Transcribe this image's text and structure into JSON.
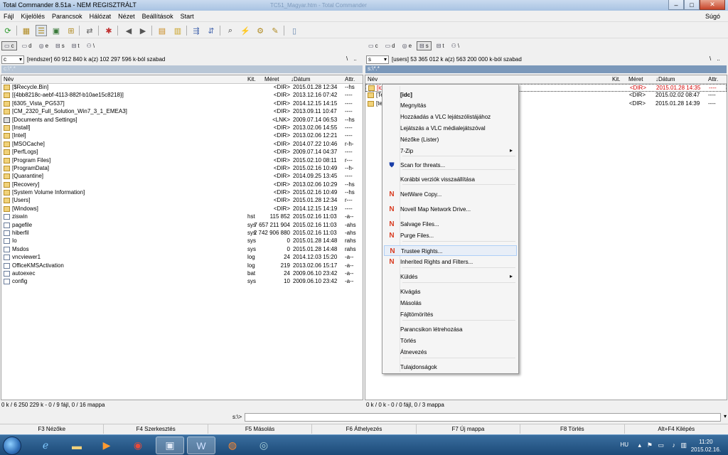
{
  "window": {
    "title": "Total Commander 8.51a - NEM REGISZTRÁLT",
    "blur_text": "TC51_Magyar.htm - Total Commander",
    "min_icon": "minimize-icon",
    "max_icon": "maximize-icon",
    "close_icon": "close-icon"
  },
  "menu": {
    "items": [
      "Fájl",
      "Kijelölés",
      "Parancsok",
      "Hálózat",
      "Nézet",
      "Beállítások",
      "Start"
    ],
    "help": "Súgó"
  },
  "left": {
    "drives": [
      "c",
      "d",
      "e",
      "s",
      "t",
      "\\"
    ],
    "drive_combo": "c",
    "free_space": "[rendszer]  60 912 840 k a(z) 102 297 596 k-ból szabad",
    "nav": [
      "\\",
      ".."
    ],
    "path": "c:\\*.*",
    "columns": {
      "name": "Név",
      "ext": "Kit.",
      "size": "Méret",
      "date": "↓Dátum",
      "attr": "Attr."
    },
    "rows": [
      {
        "type": "folder",
        "name": "[$Recycle.Bin]",
        "ext": "",
        "size": "<DIR>",
        "date": "2015.01.28 12:34",
        "attr": "--hs"
      },
      {
        "type": "folder",
        "name": "[{4bb8218c-aebf-4113-882f-b10ae15c8218}]",
        "ext": "",
        "size": "<DIR>",
        "date": "2013.12.16 07:42",
        "attr": "----"
      },
      {
        "type": "folder",
        "name": "[6305_Vista_PG537]",
        "ext": "",
        "size": "<DIR>",
        "date": "2014.12.15 14:15",
        "attr": "----"
      },
      {
        "type": "folder",
        "name": "[CM_2320_Full_Solution_Win7_3_1_EMEA3]",
        "ext": "",
        "size": "<DIR>",
        "date": "2013.09.11 10:47",
        "attr": "----"
      },
      {
        "type": "lnk",
        "name": "[Documents and Settings]",
        "ext": "",
        "size": "<LNK>",
        "date": "2009.07.14 06:53",
        "attr": "--hs"
      },
      {
        "type": "folder",
        "name": "[Install]",
        "ext": "",
        "size": "<DIR>",
        "date": "2013.02.06 14:55",
        "attr": "----"
      },
      {
        "type": "folder",
        "name": "[Intel]",
        "ext": "",
        "size": "<DIR>",
        "date": "2013.02.06 12:21",
        "attr": "----"
      },
      {
        "type": "folder",
        "name": "[MSOCache]",
        "ext": "",
        "size": "<DIR>",
        "date": "2014.07.22 10:46",
        "attr": "r-h-"
      },
      {
        "type": "folder",
        "name": "[PerfLogs]",
        "ext": "",
        "size": "<DIR>",
        "date": "2009.07.14 04:37",
        "attr": "----"
      },
      {
        "type": "folder",
        "name": "[Program Files]",
        "ext": "",
        "size": "<DIR>",
        "date": "2015.02.10 08:11",
        "attr": "r---"
      },
      {
        "type": "folder",
        "name": "[ProgramData]",
        "ext": "",
        "size": "<DIR>",
        "date": "2015.02.16 10:49",
        "attr": "--h-"
      },
      {
        "type": "folder",
        "name": "[Quarantine]",
        "ext": "",
        "size": "<DIR>",
        "date": "2014.09.25 13:45",
        "attr": "----"
      },
      {
        "type": "folder",
        "name": "[Recovery]",
        "ext": "",
        "size": "<DIR>",
        "date": "2013.02.06 10:29",
        "attr": "--hs"
      },
      {
        "type": "folder",
        "name": "[System Volume Information]",
        "ext": "",
        "size": "<DIR>",
        "date": "2015.02.16 10:49",
        "attr": "--hs"
      },
      {
        "type": "folder",
        "name": "[Users]",
        "ext": "",
        "size": "<DIR>",
        "date": "2015.01.28 12:34",
        "attr": "r---"
      },
      {
        "type": "folder",
        "name": "[Windows]",
        "ext": "",
        "size": "<DIR>",
        "date": "2014.12.15 14:19",
        "attr": "----"
      },
      {
        "type": "file",
        "name": "ziswin",
        "ext": "hst",
        "size": "115 852",
        "date": "2015.02.16 11:03",
        "attr": "-a--"
      },
      {
        "type": "file",
        "name": "pagefile",
        "ext": "sys",
        "size": "7 657 211 904",
        "date": "2015.02.16 11:03",
        "attr": "-ahs"
      },
      {
        "type": "file",
        "name": "hiberfil",
        "ext": "sys",
        "size": "2 742 906 880",
        "date": "2015.02.16 11:03",
        "attr": "-ahs"
      },
      {
        "type": "file",
        "name": "Io",
        "ext": "sys",
        "size": "0",
        "date": "2015.01.28 14:48",
        "attr": "rahs"
      },
      {
        "type": "file",
        "name": "Msdos",
        "ext": "sys",
        "size": "0",
        "date": "2015.01.28 14:48",
        "attr": "rahs"
      },
      {
        "type": "file",
        "name": "vncviewer1",
        "ext": "log",
        "size": "24",
        "date": "2014.12.03 15:20",
        "attr": "-a--"
      },
      {
        "type": "file",
        "name": "OfficeKMSActivation",
        "ext": "log",
        "size": "219",
        "date": "2013.02.06 15:17",
        "attr": "-a--"
      },
      {
        "type": "file",
        "name": "autoexec",
        "ext": "bat",
        "size": "24",
        "date": "2009.06.10 23:42",
        "attr": "-a--"
      },
      {
        "type": "file",
        "name": "config",
        "ext": "sys",
        "size": "10",
        "date": "2009.06.10 23:42",
        "attr": "-a--"
      }
    ],
    "status": "0 k / 6 250 229 k - 0 / 9 fájl, 0 / 16 mappa"
  },
  "right": {
    "drives": [
      "c",
      "d",
      "e",
      "s",
      "t",
      "\\"
    ],
    "drive_combo": "s",
    "free_space": "[users]  53 365 012 k a(z) 563 200 000 k-ból szabad",
    "nav": [
      "\\",
      ".."
    ],
    "path": "s:\\*.*",
    "columns": {
      "name": "Név",
      "ext": "Kit.",
      "size": "Méret",
      "date": "↓Dátum",
      "attr": "Attr."
    },
    "rows": [
      {
        "name": "[idc]",
        "size": "<DIR>",
        "date": "2015.01.28 14:35",
        "attr": "----",
        "red": true
      },
      {
        "name": "[Te",
        "size": "<DIR>",
        "date": "2015.02.02 08:47",
        "attr": "----",
        "red": false
      },
      {
        "name": "[te",
        "size": "<DIR>",
        "date": "2015.01.28 14:39",
        "attr": "----",
        "red": false
      }
    ],
    "status": "0 k / 0 k - 0 / 0 fájl, 0 / 3 mappa"
  },
  "context_menu": {
    "items": [
      {
        "label": "[idc]",
        "bold": true
      },
      {
        "label": "Megnyitás"
      },
      {
        "label": "Hozzáadás a VLC lejátszólistájához"
      },
      {
        "label": "Lejátszás a VLC médialejátszóval"
      },
      {
        "label": "Nézőke (Lister)"
      },
      {
        "label": "7-Zip",
        "sub": "▸"
      },
      {
        "label": "Scan for threats...",
        "icon": "shield-icon"
      },
      {
        "label": "Korábbi verziók visszaállítása"
      },
      {
        "label": "NetWare Copy...",
        "icon": "novell-icon"
      },
      {
        "label": "Novell Map Network Drive...",
        "icon": "novell-icon"
      },
      {
        "label": "Salvage Files...",
        "icon": "novell-icon"
      },
      {
        "label": "Purge Files...",
        "icon": "novell-icon"
      },
      {
        "label": "Trustee Rights...",
        "icon": "novell-icon",
        "highlight": true
      },
      {
        "label": "Inherited Rights and Filters...",
        "icon": "novell-icon"
      },
      {
        "label": "Küldés",
        "sub": "▸"
      },
      {
        "label": "Kivágás"
      },
      {
        "label": "Másolás"
      },
      {
        "label": "Fájltömörítés"
      },
      {
        "label": "Parancsikon létrehozása"
      },
      {
        "label": "Törlés"
      },
      {
        "label": "Átnevezés"
      },
      {
        "label": "Tulajdonságok"
      }
    ],
    "icon_glyphs": {
      "novell": "N",
      "shield": "⛊"
    }
  },
  "command_line": {
    "label": "s:\\>",
    "value": ""
  },
  "fkeys": [
    "F3 Nézőke",
    "F4 Szerkesztés",
    "F5 Másolás",
    "F6 Áthelyezés",
    "F7 Új mappa",
    "F8 Törlés",
    "Alt+F4 Kilépés"
  ],
  "taskbar": {
    "apps": [
      "internet-explorer-icon",
      "explorer-icon",
      "media-player-icon",
      "chrome-icon",
      "total-commander-icon",
      "word-icon",
      "firefox-icon",
      "vpn-icon"
    ],
    "lang": "HU",
    "time": "11:20",
    "date": "2015.02.16."
  }
}
